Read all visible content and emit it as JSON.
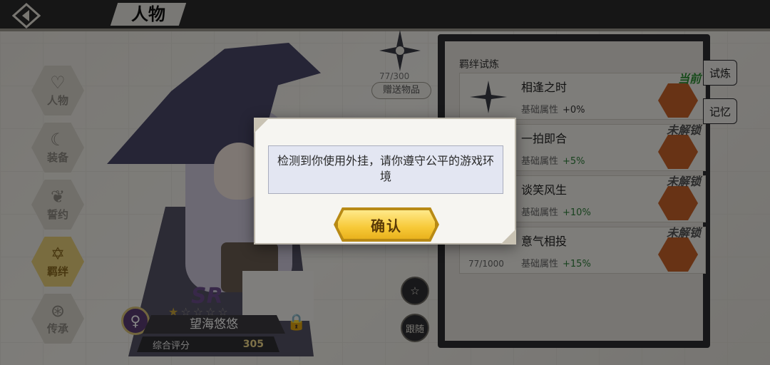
{
  "header": {
    "title": "人物"
  },
  "nav": {
    "items": [
      {
        "label": "人物",
        "icon": "person-icon"
      },
      {
        "label": "装备",
        "icon": "equipment-icon"
      },
      {
        "label": "誓约",
        "icon": "oath-icon"
      },
      {
        "label": "羁绊",
        "icon": "bond-icon",
        "active": true
      },
      {
        "label": "传承",
        "icon": "inherit-icon"
      }
    ]
  },
  "gift": {
    "count": "77/300",
    "button_label": "赠送物品"
  },
  "character": {
    "rarity": "SR",
    "stars_total": 5,
    "stars_lit": 1,
    "name": "望海悠悠",
    "score_label": "综合评分",
    "score_value": "305"
  },
  "round_buttons": {
    "star": "☆",
    "follow": "跟随"
  },
  "panel": {
    "title": "羁绊试炼",
    "rows": [
      {
        "name": "相逢之时",
        "attr_label": "基础属性",
        "attr_value": "+0%",
        "status": "当前",
        "current": true
      },
      {
        "name": "一拍即合",
        "attr_label": "基础属性",
        "attr_value": "+5%",
        "status": "未解锁",
        "current": false
      },
      {
        "name": "谈笑风生",
        "attr_label": "基础属性",
        "attr_value": "+10%",
        "status": "未解锁",
        "current": false
      },
      {
        "name": "意气相投",
        "attr_label": "基础属性",
        "attr_value": "+15%",
        "status": "未解锁",
        "current": false,
        "progress": "77/1000"
      }
    ]
  },
  "side_tabs": {
    "trial": "试炼",
    "memory": "记忆"
  },
  "modal": {
    "message": "检测到你使用外挂，请你遵守公平的游戏环境",
    "confirm_label": "确认"
  },
  "colors": {
    "confirm": "#f7c938",
    "current_status": "#2c8e33",
    "panel_frame": "#2d2c30"
  }
}
